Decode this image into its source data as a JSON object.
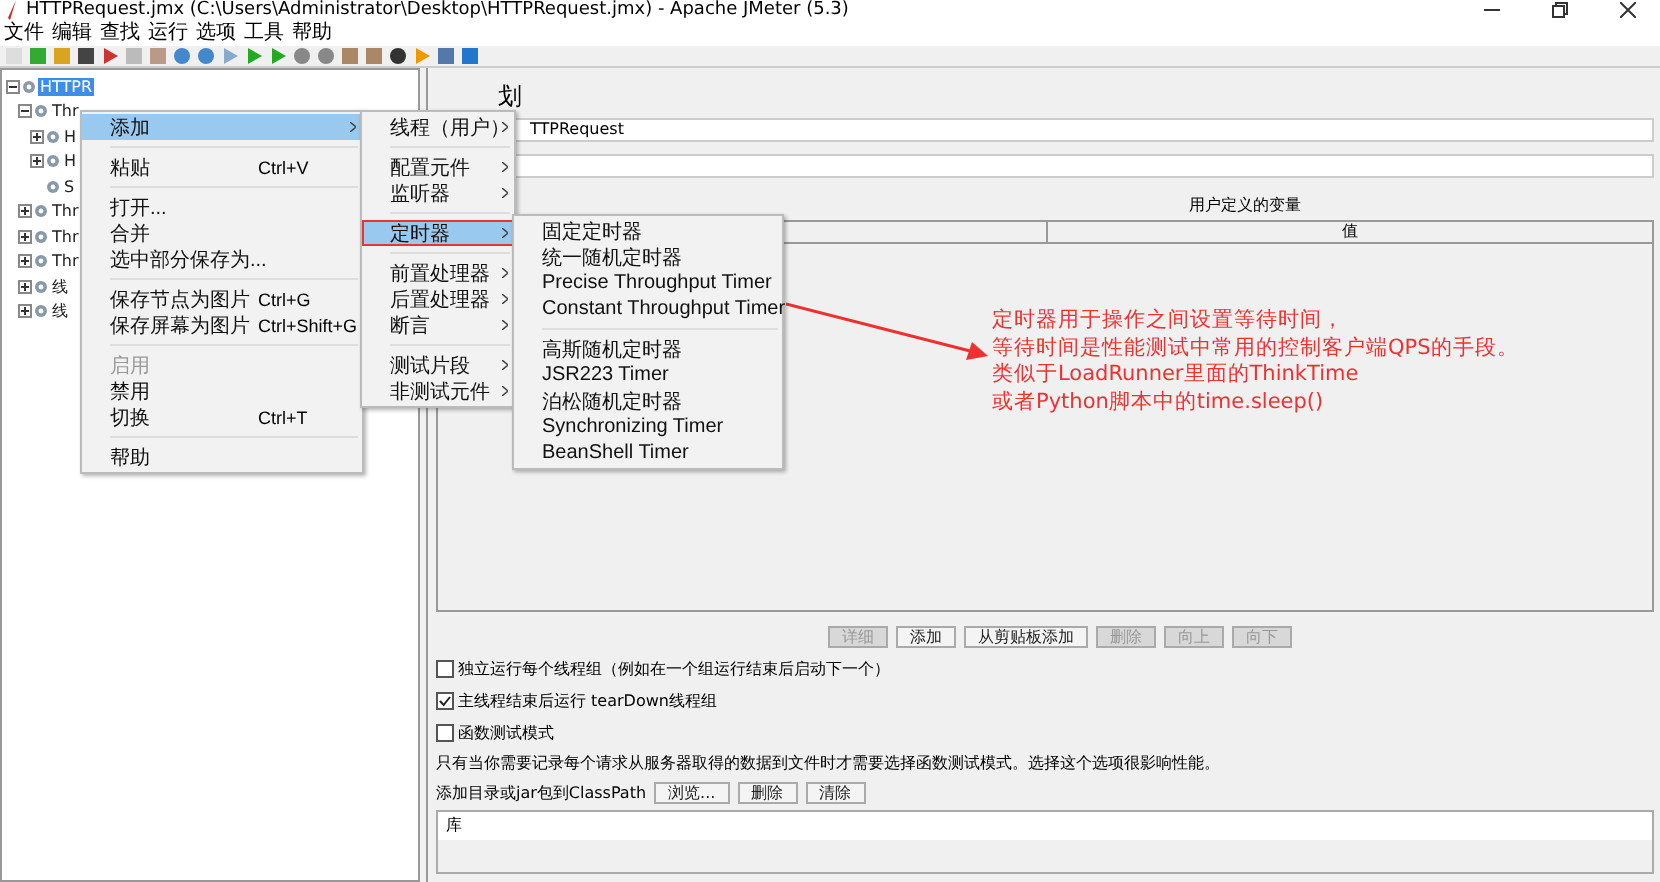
{
  "window": {
    "title": "HTTPRequest.jmx (C:\\Users\\Administrator\\Desktop\\HTTPRequest.jmx) - Apache JMeter (5.3)"
  },
  "menu_bar": [
    "文件",
    "编辑",
    "查找",
    "运行",
    "选项",
    "工具",
    "帮助"
  ],
  "tree": [
    {
      "label": "HTTPR",
      "selected": true,
      "expanded": true,
      "children": [
        {
          "label": "Thr",
          "selected": false,
          "expanded": true,
          "children": [
            {
              "label": "H",
              "selected": false,
              "expanded": false
            },
            {
              "label": "H",
              "selected": false,
              "expanded": false
            },
            {
              "label": "S",
              "selected": false
            }
          ]
        },
        {
          "label": "Thr",
          "selected": false,
          "expanded": false
        },
        {
          "label": "Thr",
          "selected": false,
          "expanded": false
        },
        {
          "label": "Thr",
          "selected": false,
          "expanded": false
        },
        {
          "label": "线",
          "selected": false,
          "expanded": false
        },
        {
          "label": "线",
          "selected": false,
          "expanded": false
        }
      ]
    }
  ],
  "panel": {
    "heading": "划",
    "name_value": "TTPRequest",
    "variables_title": "用户定义的变量",
    "variables_columns": [
      "值"
    ],
    "buttons": [
      {
        "label": "详细",
        "disabled": true
      },
      {
        "label": "添加",
        "disabled": false
      },
      {
        "label": "从剪贴板添加",
        "disabled": false
      },
      {
        "label": "删除",
        "disabled": true
      },
      {
        "label": "向上",
        "disabled": true
      },
      {
        "label": "向下",
        "disabled": true
      }
    ],
    "options": [
      {
        "label": "独立运行每个线程组（例如在一个组运行结束后启动下一个）",
        "checked": false
      },
      {
        "label": "主线程结束后运行 tearDown线程组",
        "checked": true
      },
      {
        "label": "函数测试模式",
        "checked": false
      }
    ],
    "note": "只有当你需要记录每个请求从服务器取得的数据到文件时才需要选择函数测试模式。选择这个选项很影响性能。",
    "classpath_label": "添加目录或jar包到ClassPath",
    "classpath_buttons": [
      "浏览...",
      "删除",
      "清除"
    ],
    "library_header": "库"
  },
  "context_menu": [
    {
      "kind": "item",
      "label": "添加",
      "submenu": true,
      "selected": true,
      "disabled": false
    },
    {
      "kind": "separator"
    },
    {
      "kind": "item",
      "label": "粘贴",
      "shortcut": "Ctrl+V",
      "submenu": false,
      "selected": false,
      "disabled": false
    },
    {
      "kind": "separator"
    },
    {
      "kind": "item",
      "label": "打开...",
      "submenu": false,
      "selected": false,
      "disabled": false
    },
    {
      "kind": "item",
      "label": "合并",
      "submenu": false,
      "selected": false,
      "disabled": false
    },
    {
      "kind": "item",
      "label": "选中部分保存为...",
      "submenu": false,
      "selected": false,
      "disabled": false
    },
    {
      "kind": "separator"
    },
    {
      "kind": "item",
      "label": "保存节点为图片",
      "shortcut": "Ctrl+G",
      "submenu": false,
      "selected": false,
      "disabled": false
    },
    {
      "kind": "item",
      "label": "保存屏幕为图片",
      "shortcut": "Ctrl+Shift+G",
      "submenu": false,
      "selected": false,
      "disabled": false
    },
    {
      "kind": "separator"
    },
    {
      "kind": "item",
      "label": "启用",
      "submenu": false,
      "selected": false,
      "disabled": true
    },
    {
      "kind": "item",
      "label": "禁用",
      "submenu": false,
      "selected": false,
      "disabled": false
    },
    {
      "kind": "item",
      "label": "切换",
      "shortcut": "Ctrl+T",
      "submenu": false,
      "selected": false,
      "disabled": false
    },
    {
      "kind": "separator"
    },
    {
      "kind": "item",
      "label": "帮助",
      "submenu": false,
      "selected": false,
      "disabled": false
    }
  ],
  "add_submenu": [
    {
      "kind": "item",
      "label": "线程（用户）",
      "submenu": true,
      "selected": false,
      "disabled": false
    },
    {
      "kind": "separator"
    },
    {
      "kind": "item",
      "label": "配置元件",
      "submenu": true,
      "selected": false,
      "disabled": false
    },
    {
      "kind": "item",
      "label": "监听器",
      "submenu": true,
      "selected": false,
      "disabled": false
    },
    {
      "kind": "separator"
    },
    {
      "kind": "item",
      "label": "定时器",
      "submenu": true,
      "selected": true,
      "disabled": false
    },
    {
      "kind": "separator"
    },
    {
      "kind": "item",
      "label": "前置处理器",
      "submenu": true,
      "selected": false,
      "disabled": false
    },
    {
      "kind": "item",
      "label": "后置处理器",
      "submenu": true,
      "selected": false,
      "disabled": false
    },
    {
      "kind": "item",
      "label": "断言",
      "submenu": true,
      "selected": false,
      "disabled": false
    },
    {
      "kind": "separator"
    },
    {
      "kind": "item",
      "label": "测试片段",
      "submenu": true,
      "selected": false,
      "disabled": false
    },
    {
      "kind": "item",
      "label": "非测试元件",
      "submenu": true,
      "selected": false,
      "disabled": false
    }
  ],
  "timer_submenu": [
    {
      "kind": "item",
      "label": "固定定时器",
      "submenu": false,
      "selected": false,
      "disabled": false
    },
    {
      "kind": "item",
      "label": "统一随机定时器",
      "submenu": false,
      "selected": false,
      "disabled": false
    },
    {
      "kind": "item",
      "label": "Precise Throughput Timer",
      "submenu": false,
      "selected": false,
      "disabled": false
    },
    {
      "kind": "item",
      "label": "Constant Throughput Timer",
      "submenu": false,
      "selected": false,
      "disabled": false
    },
    {
      "kind": "separator"
    },
    {
      "kind": "item",
      "label": "高斯随机定时器",
      "submenu": false,
      "selected": false,
      "disabled": false
    },
    {
      "kind": "item",
      "label": "JSR223 Timer",
      "submenu": false,
      "selected": false,
      "disabled": false
    },
    {
      "kind": "item",
      "label": "泊松随机定时器",
      "submenu": false,
      "selected": false,
      "disabled": false
    },
    {
      "kind": "item",
      "label": "Synchronizing Timer",
      "submenu": false,
      "selected": false,
      "disabled": false
    },
    {
      "kind": "item",
      "label": "BeanShell Timer",
      "submenu": false,
      "selected": false,
      "disabled": false
    }
  ],
  "annotation": [
    "定时器用于操作之间设置等待时间，",
    "等待时间是性能测试中常用的控制客户端QPS的手段。",
    "类似于LoadRunner里面的ThinkTime",
    "或者Python脚本中的time.sleep()"
  ]
}
